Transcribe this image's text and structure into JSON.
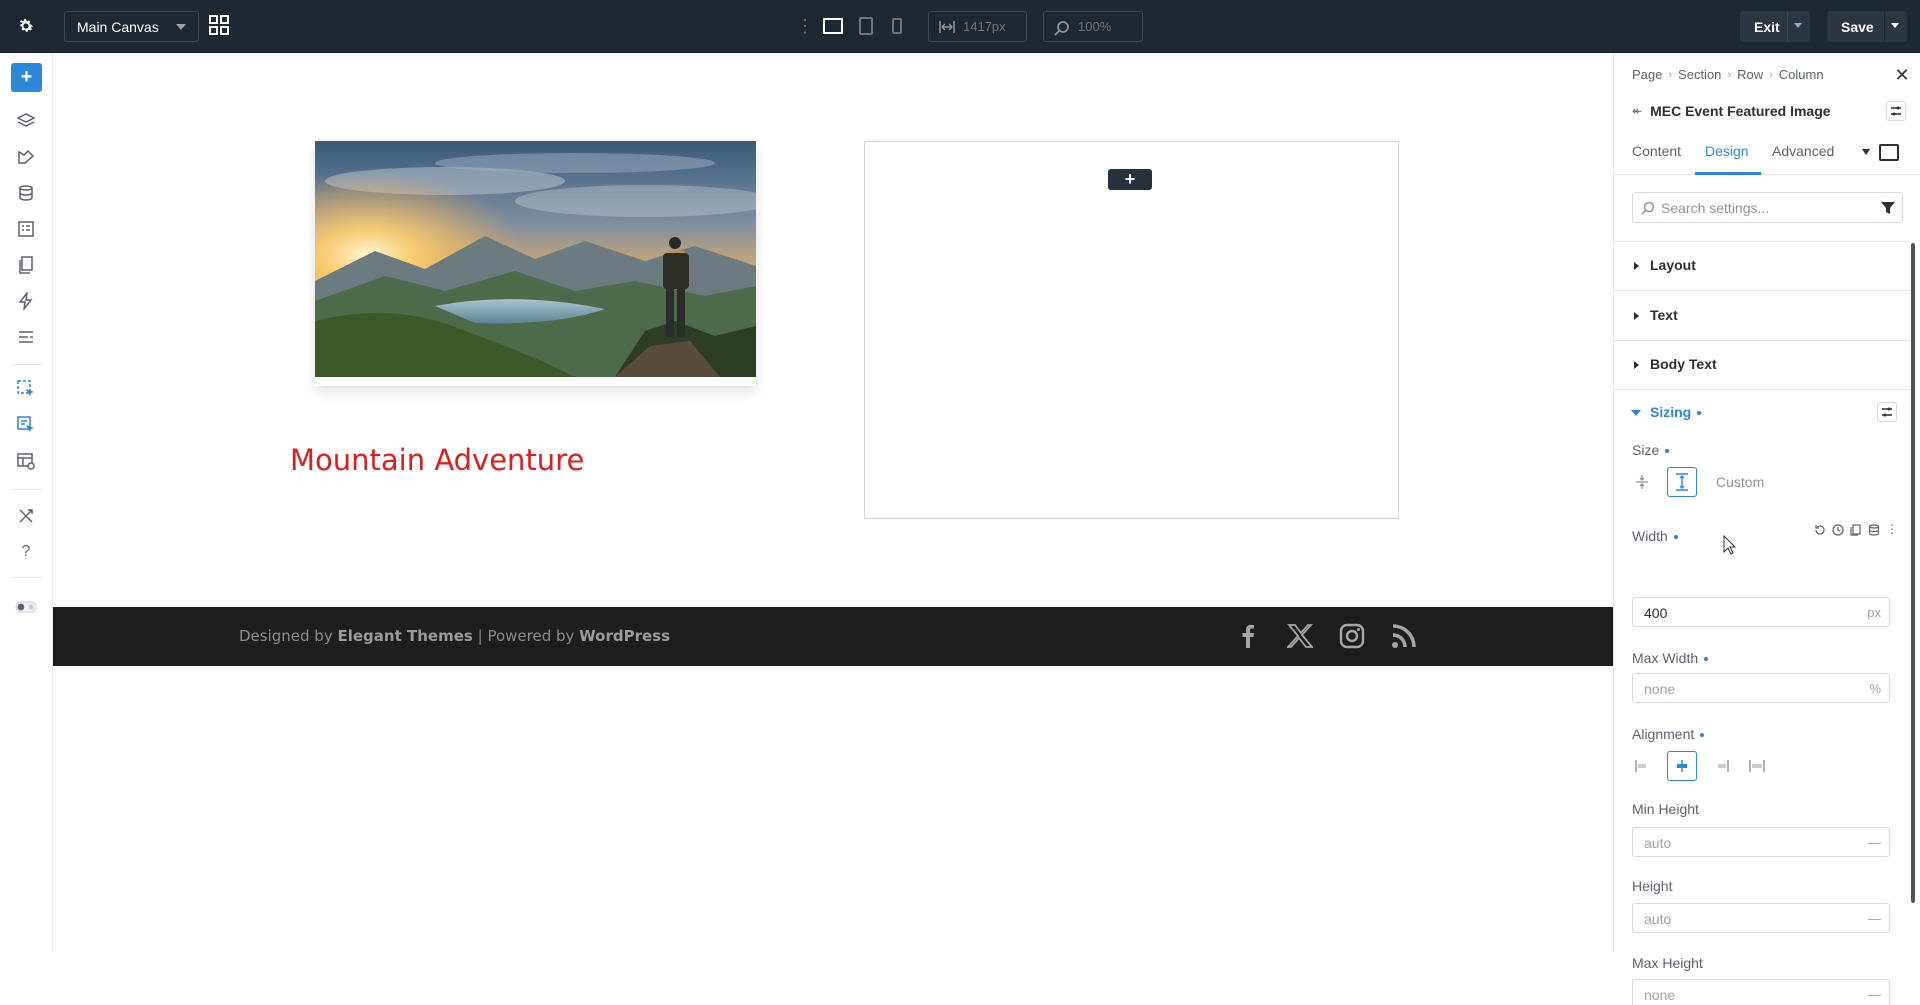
{
  "topbar": {
    "canvas_selector": "Main Canvas",
    "width_readout": "1417px",
    "zoom_readout": "100%",
    "exit_label": "Exit",
    "save_label": "Save"
  },
  "canvas": {
    "event_title": "Mountain Adventure",
    "image_alt": "Hiker on mountain at sunset",
    "footer": {
      "designed_by": "Designed by",
      "elegant_themes": "Elegant Themes",
      "separator": "|",
      "powered_by": "Powered by",
      "wordpress": "WordPress"
    },
    "social_icons": [
      "facebook-icon",
      "x-twitter-icon",
      "instagram-icon",
      "rss-icon"
    ]
  },
  "panel": {
    "breadcrumb": [
      "Page",
      "Section",
      "Row",
      "Column"
    ],
    "module_title": "MEC Event Featured Image",
    "tabs": [
      "Content",
      "Design",
      "Advanced"
    ],
    "active_tab": "Design",
    "search_placeholder": "Search settings...",
    "groups": [
      "Layout",
      "Text",
      "Body Text"
    ],
    "sizing": {
      "title": "Sizing",
      "size_label": "Size",
      "size_custom": "Custom",
      "width_label": "Width",
      "width_value": "400",
      "width_unit": "px",
      "max_width_label": "Max Width",
      "max_width_placeholder": "none",
      "max_width_unit": "%",
      "alignment_label": "Alignment",
      "min_height_label": "Min Height",
      "min_height_placeholder": "auto",
      "height_label": "Height",
      "height_placeholder": "auto",
      "max_height_label": "Max Height",
      "max_height_placeholder": "none",
      "dash": "—"
    }
  },
  "colors": {
    "accent": "#2b87da",
    "topbar_bg": "#1f2733",
    "title_red": "#e31b1b",
    "footer_bg": "#1e1e1e"
  }
}
